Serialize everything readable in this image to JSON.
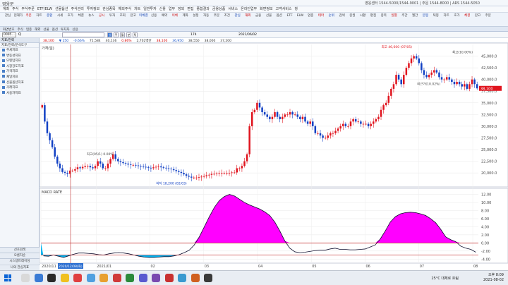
{
  "window": {
    "title": "영웅문",
    "right_info": "영웅센터 1544-5000/1544-9001 | 주문 1544-8000 | ARS 1544-5050"
  },
  "menu": [
    "계좌",
    "주식",
    "주식주문",
    "ETF/ELW",
    "선물옵션",
    "주식관리",
    "투자정보",
    "관심종목",
    "해외주식",
    "차트",
    "일반투자",
    "신용",
    "업무",
    "장외",
    "편집",
    "종합결과",
    "금융상품",
    "서비스",
    "온라인업무",
    "화면정보",
    "고객서비스",
    "창"
  ],
  "quickbar": [
    "관심",
    "현재가",
    "주문",
    "차트",
    "종합",
    "시세",
    "호가",
    "체결",
    "뉴스",
    "공시",
    "투자",
    "조회",
    "잔고",
    "미체결",
    "신용",
    "예약",
    "이체",
    "계좌",
    "설정",
    "자동",
    "주문",
    "조건",
    "관심",
    "해외",
    "금융",
    "선물",
    "옵션",
    "ETF",
    "ELW",
    "업종",
    "테마",
    "순위",
    "검색",
    "증권",
    "시황",
    "편집",
    "종목",
    "일별",
    "주간",
    "월간",
    "분봉",
    "틱봉",
    "차트",
    "호가",
    "체결",
    "잔고",
    "주문"
  ],
  "tabstrip": [
    "화면번호",
    "주식",
    "업종",
    "해외",
    "선물",
    "옵션",
    "투자자",
    "신용"
  ],
  "stock": {
    "code": "0005...",
    "name": "Q",
    "periods": [
      "일",
      "주",
      "월",
      "분",
      "틱"
    ],
    "date": "2021/06/02",
    "zoom": "174"
  },
  "pricebar": {
    "price": "38,100",
    "change": "▼ 250",
    "rate": "-0.66%",
    "volume": "71,584",
    "open": "40,136",
    "rate2": "0.86%",
    "value": "2,702백만",
    "high": "38,100",
    "low": "36,950",
    "close": "38,550",
    "v2": "38,000",
    "v3": "37,200"
  },
  "sidebar": {
    "tabs": "지표/전략",
    "search": "지표/전략/분석도구",
    "items": [
      "추세지표",
      "변동성지표",
      "모멘텀지표",
      "시장강도지표",
      "가격지표",
      "채널지표",
      "선물옵션지표",
      "거래지표",
      "사용자지표"
    ],
    "bottom": [
      "선호검색",
      "오름차순",
      "시스템트레이딩",
      "나의 관심지표"
    ]
  },
  "chart_data": {
    "type": "candlestick",
    "price_panel": {
      "label": "가격(일)",
      "ylim": [
        17000,
        47500
      ],
      "yticks": [
        20000,
        22500,
        25000,
        27500,
        30000,
        32500,
        35000,
        37500,
        40000,
        42500,
        45000
      ],
      "high_label": "최고 46,600 (07/05)",
      "low_label": "최저 18,200 (02/03)",
      "annotations": [
        "최고(05/1) 0.00%",
        "최근가(10.02%)",
        "최고(10.00%)"
      ],
      "last_price": "38,100",
      "close": [
        34500,
        31000,
        28500,
        27000,
        25500,
        23500,
        22000,
        21000,
        20200,
        20000,
        19800,
        20500,
        20500,
        20800,
        21200,
        21000,
        21300,
        21500,
        21500,
        21200,
        21000,
        21500,
        22500,
        22000,
        21000,
        21000,
        22000,
        23000,
        24000,
        23000,
        22500,
        22300,
        22100,
        22000,
        21800,
        21700,
        21700,
        21600,
        21500,
        21400,
        21300,
        21200,
        21100,
        21000,
        21200,
        21300,
        21400,
        21200,
        21100,
        21000,
        20900,
        20800,
        20600,
        20400,
        20200,
        20000,
        19700,
        19400,
        19200,
        19000,
        19000,
        19000,
        19100,
        19200,
        19300,
        19500,
        19600,
        19800,
        19800,
        19900,
        20000,
        20000,
        20000,
        20000,
        20000,
        20100,
        20100,
        21000,
        21000,
        21500,
        22500,
        24000,
        30000,
        33000,
        33500,
        35000,
        34000,
        33000,
        32500,
        32000,
        31500,
        32000,
        33000,
        32000,
        31500,
        32000,
        32500,
        32500,
        33000,
        32500,
        32500,
        32000,
        31500,
        32000,
        31000,
        30500,
        31000,
        30000,
        28500,
        28500,
        28000,
        27500,
        27500,
        28000,
        28500,
        28500,
        29000,
        29500,
        30000,
        30500,
        30000,
        30000,
        31000,
        31500,
        31000,
        31000,
        30500,
        30500,
        30500,
        30000,
        30500,
        31000,
        31500,
        32000,
        33500,
        34500,
        35000,
        36500,
        38000,
        39000,
        41000,
        40000,
        39000,
        41000,
        42500,
        43500,
        44500,
        45000,
        44500,
        43500,
        42000,
        41000,
        40500,
        41000,
        41500,
        42000,
        41500,
        40500,
        40000,
        40000,
        40500,
        40000,
        39500,
        39000,
        39500,
        39000,
        38500,
        39000,
        38000,
        39000,
        40000,
        39000,
        38100
      ]
    },
    "macd_panel": {
      "label": "MACD RATE",
      "yticks": [
        12.0,
        10.0,
        8.0,
        6.0,
        4.0,
        2.0,
        0.0,
        -2.0,
        -4.0
      ],
      "ylim": [
        -5,
        13.5
      ],
      "signal_lines": [
        0.0,
        -3.0
      ],
      "values": [
        -3.2,
        -3.3,
        -3.0,
        -3.3,
        -3.6,
        -3.2,
        -2.8,
        -2.5,
        -2.5,
        -2.6,
        -2.7,
        -2.9,
        -3.0,
        -2.7,
        -2.5,
        -2.4,
        -2.5,
        -2.7,
        -3.0,
        -3.3,
        -3.5,
        -3.6,
        -3.6,
        -3.5,
        -3.4,
        -3.4,
        -3.2,
        -2.9,
        -2.4,
        -1.8,
        -0.5,
        1.5,
        4.0,
        6.5,
        8.8,
        10.5,
        11.5,
        12.0,
        11.6,
        10.8,
        10.0,
        9.4,
        8.9,
        8.4,
        7.7,
        6.8,
        5.2,
        3.0,
        0.5,
        -1.3,
        -2.2,
        -2.4,
        -2.3,
        -2.1,
        -1.9,
        -1.8,
        -1.8,
        -1.5,
        -1.3,
        -1.6,
        -1.6,
        -1.7,
        -1.7,
        -1.6,
        -1.5,
        -1.0,
        -0.5,
        1.0,
        3.0,
        5.2,
        6.5,
        7.2,
        7.5,
        7.6,
        7.5,
        7.2,
        6.8,
        6.0,
        5.0,
        3.4,
        1.5,
        0.8,
        0.3,
        -0.8,
        -1.3,
        -1.6,
        -2.3
      ]
    },
    "xticks": [
      "2020/11",
      "2021/01",
      "02",
      "03",
      "04",
      "05",
      "06",
      "07",
      "08"
    ],
    "cursor_date": "2020/12/08(화)"
  },
  "taskbar": {
    "weather": "25°C 대체로 흐림",
    "time": "오후 8:09",
    "date": "2021-08-02"
  },
  "colors": {
    "up": "#e0141e",
    "down": "#1241c4",
    "macd_pos": "#ff00ff",
    "macd_neg": "#00b4f0",
    "grid": "#e8e8e8"
  }
}
